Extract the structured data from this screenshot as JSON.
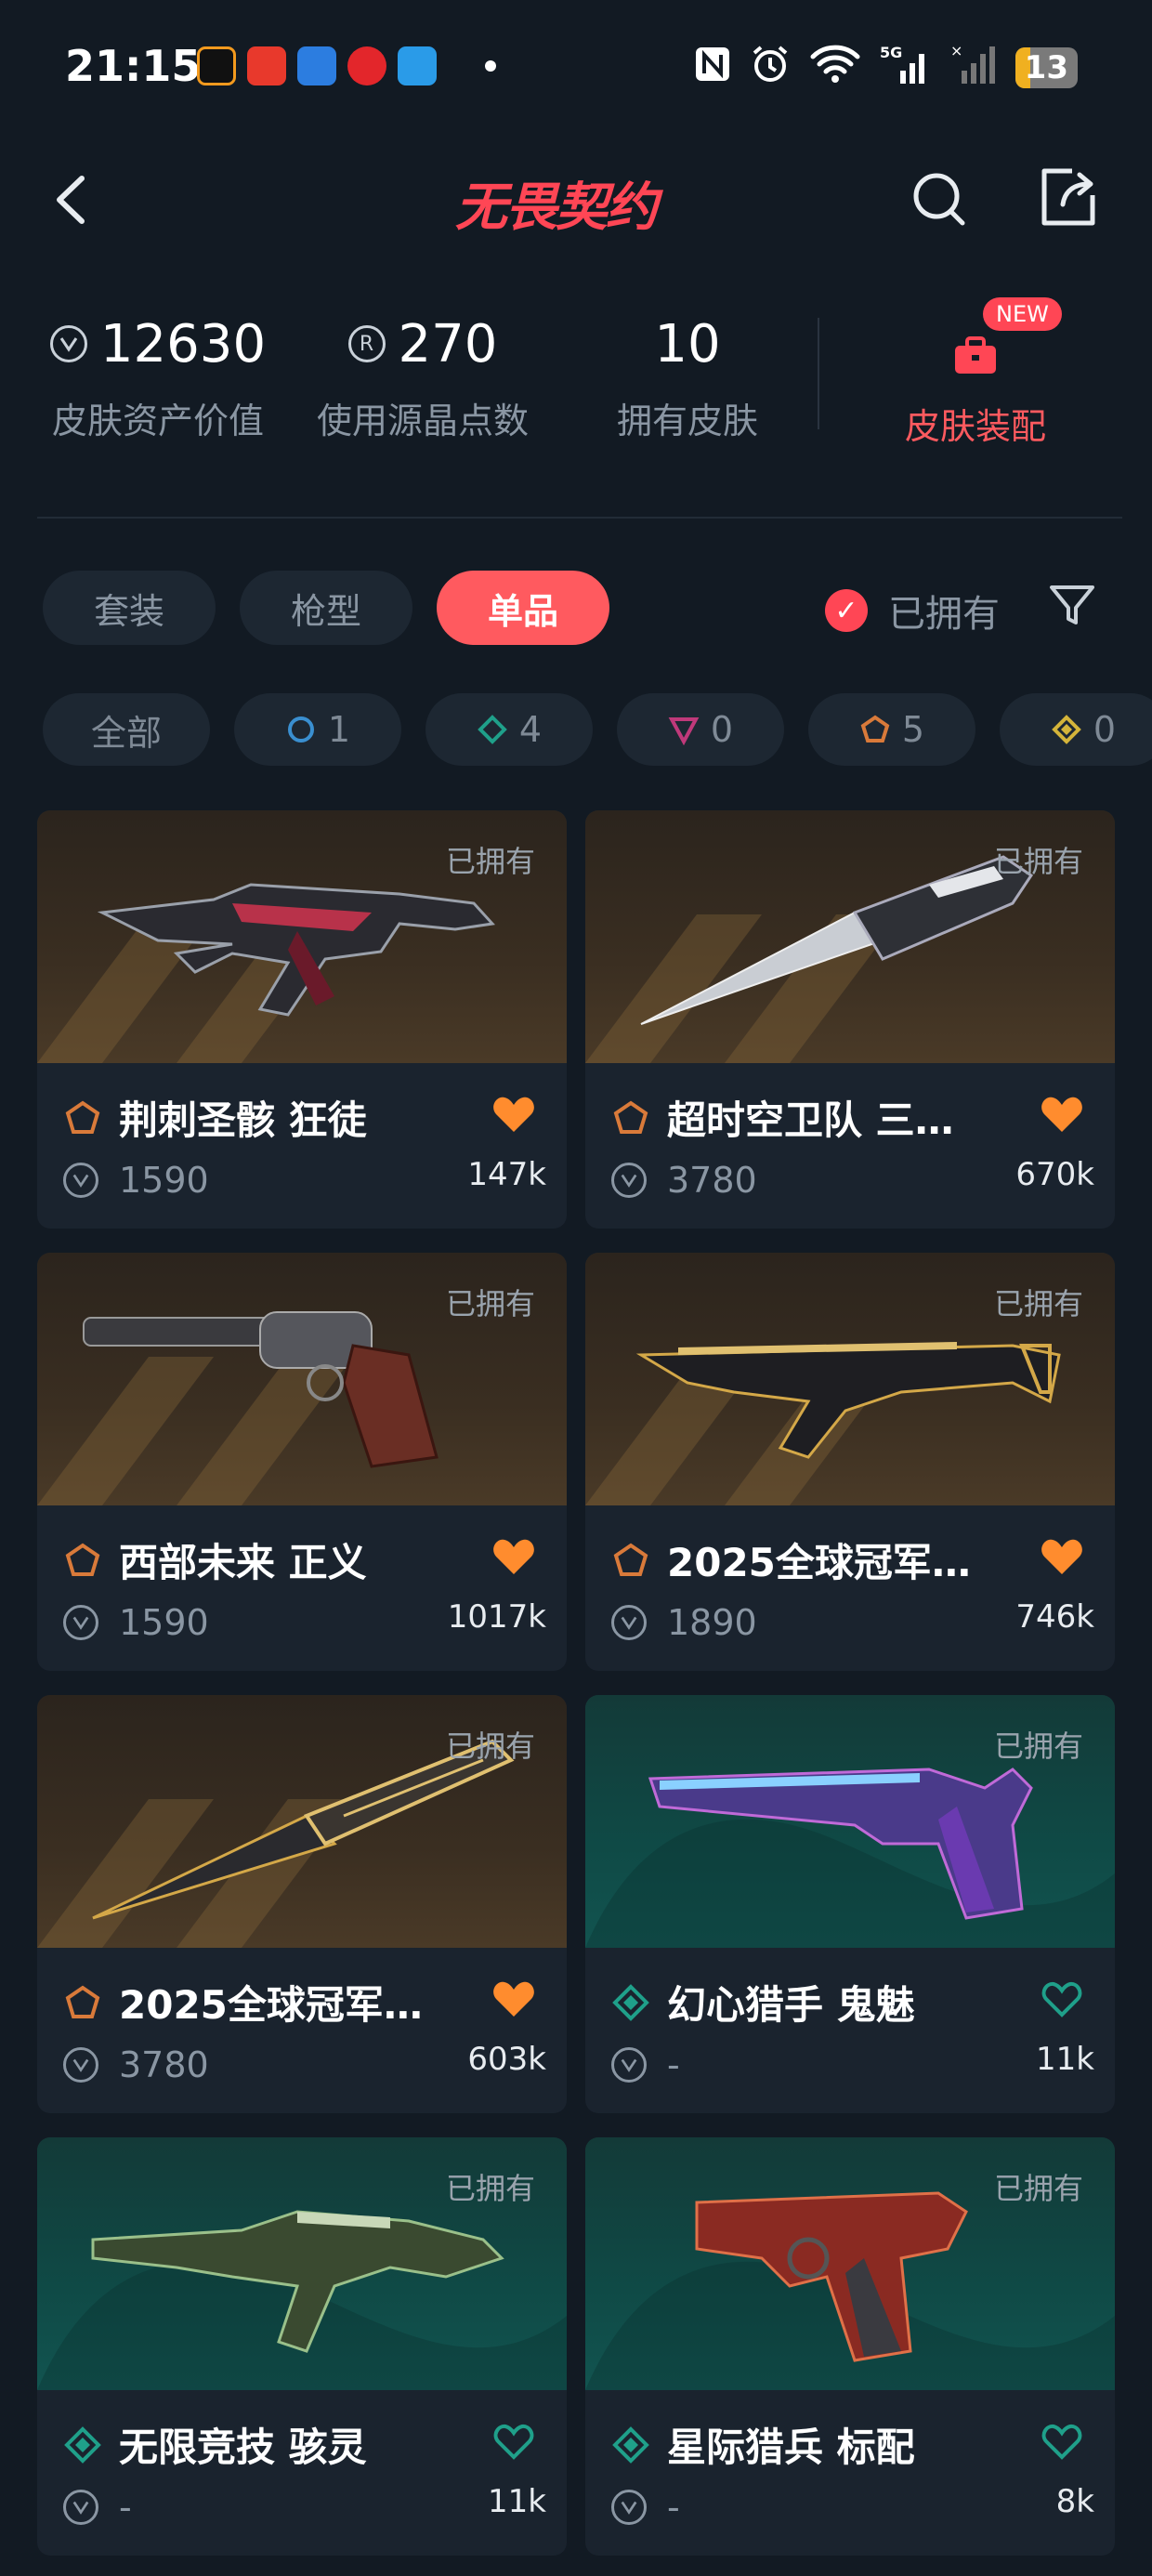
{
  "status_bar": {
    "time": "21:15",
    "battery": "13",
    "network": "5G"
  },
  "header": {
    "logo": "无畏契约"
  },
  "stats": [
    {
      "value": "12630",
      "label": "皮肤资产价值",
      "icon": "vp-coin-icon"
    },
    {
      "value": "270",
      "label": "使用源晶点数",
      "icon": "radianite-icon"
    },
    {
      "value": "10",
      "label": "拥有皮肤",
      "icon": ""
    }
  ],
  "loadout": {
    "new_badge": "NEW",
    "label": "皮肤装配"
  },
  "tabs": [
    {
      "label": "套装",
      "active": false
    },
    {
      "label": "枪型",
      "active": false
    },
    {
      "label": "单品",
      "active": true
    }
  ],
  "owned_filter": {
    "label": "已拥有",
    "checked": true
  },
  "rarity_chips": [
    {
      "label": "全部",
      "icon": ""
    },
    {
      "label": "1",
      "icon": "select-tier-icon",
      "color": "#3a8fd0"
    },
    {
      "label": "4",
      "icon": "deluxe-tier-icon",
      "color": "#1fa08a"
    },
    {
      "label": "0",
      "icon": "premium-tier-icon",
      "color": "#c0397a"
    },
    {
      "label": "5",
      "icon": "exclusive-tier-icon",
      "color": "#d97a3a"
    },
    {
      "label": "0",
      "icon": "ultra-tier-icon",
      "color": "#d4b43a"
    }
  ],
  "cards": [
    {
      "name": "荆刺圣骸 狂徒",
      "price": "1590",
      "likes": "147k",
      "owned": "已拥有",
      "tier": "exclusive",
      "liked": true,
      "bg": "brown",
      "weapon": "vandal"
    },
    {
      "name": "超时空卫队 三…",
      "price": "3780",
      "likes": "670k",
      "owned": "已拥有",
      "tier": "exclusive",
      "liked": true,
      "bg": "brown",
      "weapon": "knife"
    },
    {
      "name": "西部未来 正义",
      "price": "1590",
      "likes": "1017k",
      "owned": "已拥有",
      "tier": "exclusive",
      "liked": true,
      "bg": "brown",
      "weapon": "revolver"
    },
    {
      "name": "2025全球冠军…",
      "price": "1890",
      "likes": "746k",
      "owned": "已拥有",
      "tier": "exclusive",
      "liked": true,
      "bg": "brown",
      "weapon": "rifle"
    },
    {
      "name": "2025全球冠军…",
      "price": "3780",
      "likes": "603k",
      "owned": "已拥有",
      "tier": "exclusive",
      "liked": true,
      "bg": "brown",
      "weapon": "knife2"
    },
    {
      "name": "幻心猎手 鬼魅",
      "price": "-",
      "likes": "11k",
      "owned": "已拥有",
      "tier": "deluxe",
      "liked": false,
      "bg": "teal",
      "weapon": "pistol"
    },
    {
      "name": "无限竞技 骇灵",
      "price": "-",
      "likes": "11k",
      "owned": "已拥有",
      "tier": "deluxe",
      "liked": false,
      "bg": "teal",
      "weapon": "smg"
    },
    {
      "name": "星际猎兵 标配",
      "price": "-",
      "likes": "8k",
      "owned": "已拥有",
      "tier": "deluxe",
      "liked": false,
      "bg": "teal",
      "weapon": "classic"
    }
  ],
  "colors": {
    "accent": "#ff4655",
    "heart": "#ff8c2e",
    "deluxe": "#1fa08a",
    "exclusive": "#d97a3a"
  }
}
